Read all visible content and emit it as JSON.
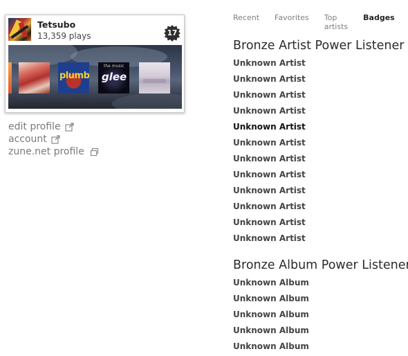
{
  "profile": {
    "username": "Tetsubo",
    "plays": "13,359 plays",
    "badge_count": "17",
    "album_covers": [
      {
        "name": "orange-cover"
      },
      {
        "name": "red-figure-cover"
      },
      {
        "name": "plumb-cover",
        "text": "plumb"
      },
      {
        "name": "glee-cover",
        "text": "glee",
        "small_text": "the music"
      },
      {
        "name": "pale-landscape-cover"
      }
    ]
  },
  "links": {
    "edit_profile": "edit profile",
    "account": "account",
    "zune_profile": "zune.net profile"
  },
  "tabs": [
    {
      "label": "Recent",
      "active": false
    },
    {
      "label": "Favorites",
      "active": false
    },
    {
      "label": "Top artists",
      "active": false
    },
    {
      "label": "Badges",
      "active": true
    }
  ],
  "sections": {
    "artist": {
      "title": "Bronze Artist Power Listener",
      "items": [
        "Unknown Artist",
        "Unknown Artist",
        "Unknown Artist",
        "Unknown Artist",
        "Unknown Artist",
        "Unknown Artist",
        "Unknown Artist",
        "Unknown Artist",
        "Unknown Artist",
        "Unknown Artist",
        "Unknown Artist",
        "Unknown Artist"
      ]
    },
    "album": {
      "title": "Bronze Album Power Listener",
      "items": [
        "Unknown Album",
        "Unknown Album",
        "Unknown Album",
        "Unknown Album",
        "Unknown Album"
      ]
    }
  },
  "colors": {
    "link_gray": "#7a7a7a",
    "tab_inactive": "#7f7f7f",
    "tab_active": "#222222",
    "badge_bg": "#2e2e2e"
  }
}
